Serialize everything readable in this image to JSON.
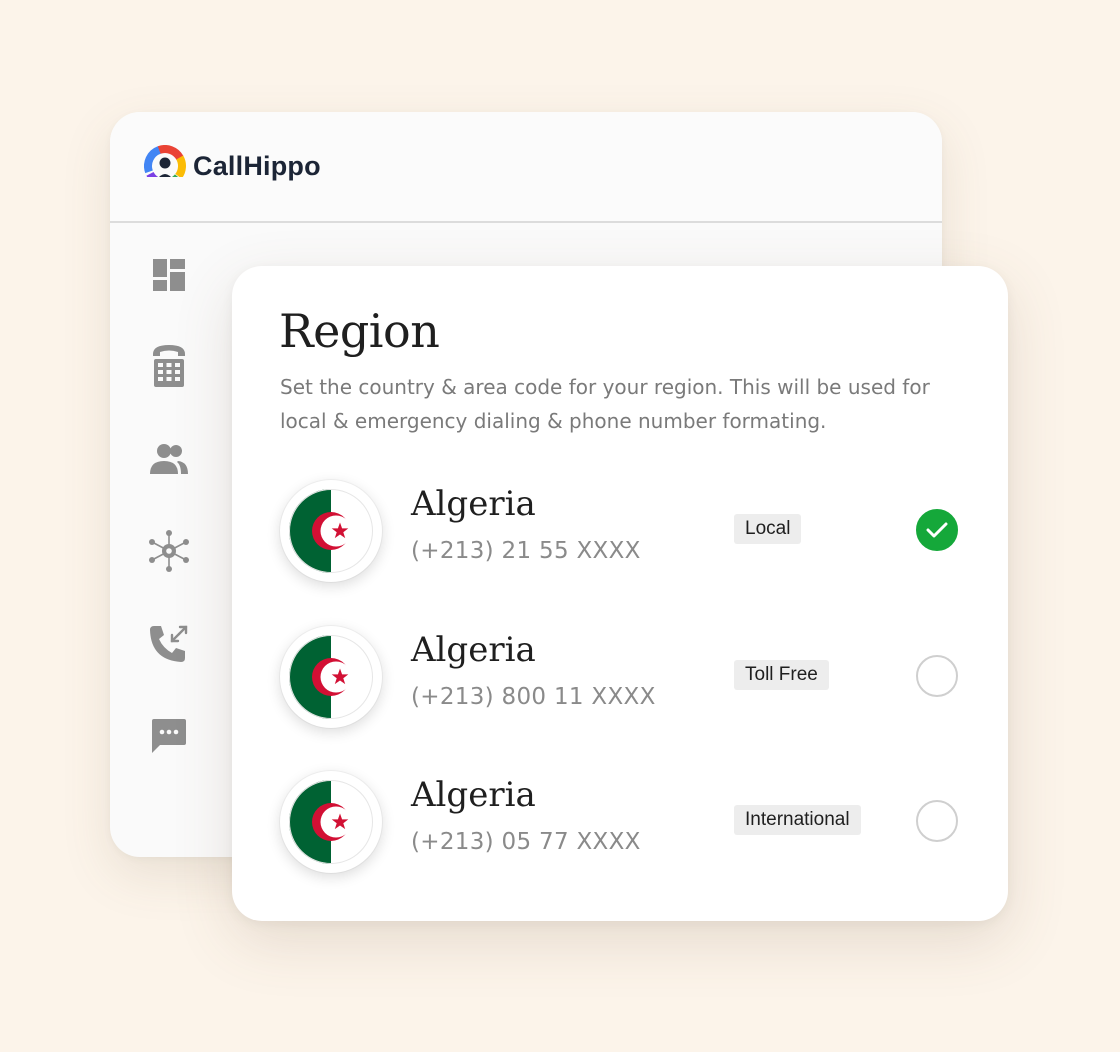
{
  "app": {
    "brand_name": "CallHippo",
    "brand_icon": "callhippo-logo-icon"
  },
  "sidebar": {
    "items": [
      {
        "icon": "dashboard-icon"
      },
      {
        "icon": "dialpad-icon"
      },
      {
        "icon": "contacts-icon"
      },
      {
        "icon": "integrations-icon"
      },
      {
        "icon": "call-logs-icon"
      },
      {
        "icon": "messages-icon"
      }
    ]
  },
  "region": {
    "title": "Region",
    "description": "Set the country & area code for your region. This will be used for local & emergency dialing & phone number formating.",
    "options": [
      {
        "country": "Algeria",
        "number": "(+213) 21 55 XXXX",
        "type": "Local",
        "selected": true
      },
      {
        "country": "Algeria",
        "number": "(+213) 800 11 XXXX",
        "type": "Toll Free",
        "selected": false
      },
      {
        "country": "Algeria",
        "number": "(+213) 05 77 XXXX",
        "type": "International",
        "selected": false
      }
    ]
  },
  "colors": {
    "background": "#fcf4ea",
    "selected_green": "#15a83a",
    "flag_green": "#006233",
    "flag_red": "#d21034"
  }
}
